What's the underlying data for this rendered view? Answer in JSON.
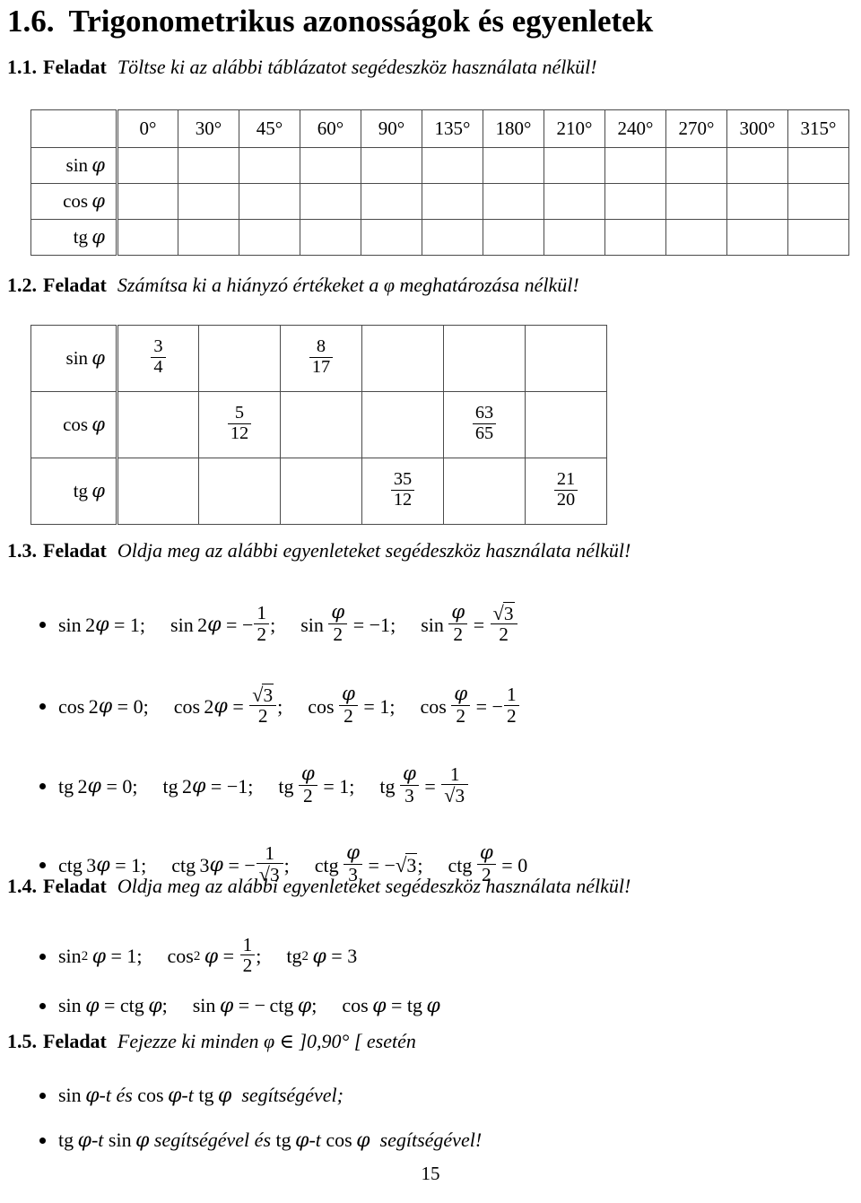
{
  "chapter": {
    "number": "1.6.",
    "title": "Trigonometrikus azonosságok és egyenletek"
  },
  "tasks": {
    "t1": {
      "number": "1.1.",
      "word": "Feladat",
      "desc": "Töltse ki az alábbi táblázatot segédeszköz használata nélkül!"
    },
    "t2": {
      "number": "1.2.",
      "word": "Feladat",
      "desc": "Számítsa ki a hiányzó értékeket a φ meghatározása nélkül!"
    },
    "t3": {
      "number": "1.3.",
      "word": "Feladat",
      "desc": "Oldja meg az alábbi egyenleteket segédeszköz használata nélkül!"
    },
    "t4": {
      "number": "1.4.",
      "word": "Feladat",
      "desc": "Oldja meg az alábbi egyenleteket segédeszköz használata nélkül!"
    },
    "t5": {
      "number": "1.5.",
      "word": "Feladat",
      "desc": "Fejezze ki minden φ ∈ ]0,90° [ esetén"
    }
  },
  "angle_table": {
    "corner": "",
    "angles": [
      "0°",
      "30°",
      "45°",
      "60°",
      "90°",
      "135°",
      "180°",
      "210°",
      "240°",
      "270°",
      "300°",
      "315°"
    ],
    "rows": [
      {
        "label_fn": "sin",
        "label_arg": "φ",
        "cells": [
          "",
          "",
          "",
          "",
          "",
          "",
          "",
          "",
          "",
          "",
          "",
          ""
        ]
      },
      {
        "label_fn": "cos",
        "label_arg": "φ",
        "cells": [
          "",
          "",
          "",
          "",
          "",
          "",
          "",
          "",
          "",
          "",
          "",
          ""
        ]
      },
      {
        "label_fn": "tg",
        "label_arg": "φ",
        "cells": [
          "",
          "",
          "",
          "",
          "",
          "",
          "",
          "",
          "",
          "",
          "",
          ""
        ]
      }
    ]
  },
  "value_table": {
    "column_count": 6,
    "rows": [
      {
        "label_fn": "sin",
        "label_arg": "φ",
        "cells": [
          {
            "num": "3",
            "den": "4"
          },
          {
            "num": "",
            "den": ""
          },
          {
            "num": "8",
            "den": "17"
          },
          {
            "num": "",
            "den": ""
          },
          {
            "num": "",
            "den": ""
          },
          {
            "num": "",
            "den": ""
          }
        ]
      },
      {
        "label_fn": "cos",
        "label_arg": "φ",
        "cells": [
          {
            "num": "",
            "den": ""
          },
          {
            "num": "5",
            "den": "12"
          },
          {
            "num": "",
            "den": ""
          },
          {
            "num": "",
            "den": ""
          },
          {
            "num": "63",
            "den": "65"
          },
          {
            "num": "",
            "den": ""
          }
        ]
      },
      {
        "label_fn": "tg",
        "label_arg": "φ",
        "cells": [
          {
            "num": "",
            "den": ""
          },
          {
            "num": "",
            "den": ""
          },
          {
            "num": "",
            "den": ""
          },
          {
            "num": "35",
            "den": "12"
          },
          {
            "num": "",
            "den": ""
          },
          {
            "num": "21",
            "den": "20"
          }
        ]
      }
    ]
  },
  "eq13": {
    "line1": {
      "e1": {
        "fn": "sin",
        "arg_pre": "2",
        "arg": "φ",
        "rel": "=",
        "rhs": "1",
        "term": ";"
      },
      "e2": {
        "fn": "sin",
        "arg_pre": "2",
        "arg": "φ",
        "rel": "=",
        "sign": "−",
        "num": "1",
        "den": "2",
        "term": ";"
      },
      "e3": {
        "fn": "sin",
        "arg": "φ",
        "arg_den": "2",
        "rel": "=",
        "rhs": "−1",
        "term": ";"
      },
      "e4": {
        "fn": "sin",
        "arg": "φ",
        "arg_den": "2",
        "rel": "=",
        "num_sqrt": "3",
        "den": "2",
        "term": ""
      }
    },
    "line2": {
      "e1": {
        "fn": "cos",
        "arg_pre": "2",
        "arg": "φ",
        "rel": "=",
        "rhs": "0",
        "term": ";"
      },
      "e2": {
        "fn": "cos",
        "arg_pre": "2",
        "arg": "φ",
        "rel": "=",
        "num_sqrt": "3",
        "den": "2",
        "term": ";"
      },
      "e3": {
        "fn": "cos",
        "arg": "φ",
        "arg_den": "2",
        "rel": "=",
        "rhs": "1",
        "term": ";"
      },
      "e4": {
        "fn": "cos",
        "arg": "φ",
        "arg_den": "2",
        "rel": "=",
        "sign": "−",
        "num": "1",
        "den": "2",
        "term": ""
      }
    },
    "line3": {
      "e1": {
        "fn": "tg",
        "arg_pre": "2",
        "arg": "φ",
        "rel": "=",
        "rhs": "0",
        "term": ";"
      },
      "e2": {
        "fn": "tg",
        "arg_pre": "2",
        "arg": "φ",
        "rel": "=",
        "rhs": "−1",
        "term": ";"
      },
      "e3": {
        "fn": "tg",
        "arg": "φ",
        "arg_den": "2",
        "rel": "=",
        "rhs": "1",
        "term": ";"
      },
      "e4": {
        "fn": "tg",
        "arg": "φ",
        "arg_den": "3",
        "rel": "=",
        "num": "1",
        "den_sqrt": "3",
        "term": ""
      }
    },
    "line4": {
      "e1": {
        "fn": "ctg",
        "arg_pre": "3",
        "arg": "φ",
        "rel": "=",
        "rhs": "1",
        "term": ";"
      },
      "e2": {
        "fn": "ctg",
        "arg_pre": "3",
        "arg": "φ",
        "rel": "=",
        "sign": "−",
        "num": "1",
        "den_sqrt": "3",
        "term": ";"
      },
      "e3": {
        "fn": "ctg",
        "arg": "φ",
        "arg_den": "3",
        "rel": "=",
        "rhs_sign": "−",
        "rhs_sqrt": "3",
        "term": ";"
      },
      "e4": {
        "fn": "ctg",
        "arg": "φ",
        "arg_den": "2",
        "rel": "=",
        "rhs": "0",
        "term": ""
      }
    }
  },
  "eq14": {
    "line1": {
      "e1": {
        "fn": "sin",
        "power": "2",
        "arg": "φ",
        "rel": "=",
        "rhs": "1",
        "term": ";"
      },
      "e2": {
        "fn": "cos",
        "power": "2",
        "arg": "φ",
        "rel": "=",
        "num": "1",
        "den": "2",
        "term": ";"
      },
      "e3": {
        "fn": "tg",
        "power": "2",
        "arg": "φ",
        "rel": "=",
        "rhs": "3",
        "term": ""
      }
    },
    "line2": {
      "e1": {
        "lhs_fn": "sin",
        "lhs_arg": "φ",
        "rel": "=",
        "rhs_fn": "ctg",
        "rhs_arg": "φ",
        "term": ";"
      },
      "e2": {
        "lhs_fn": "sin",
        "lhs_arg": "φ",
        "rel": "=",
        "sign": "−",
        "rhs_fn": "ctg",
        "rhs_arg": "φ",
        "term": ";"
      },
      "e3": {
        "lhs_fn": "cos",
        "lhs_arg": "φ",
        "rel": "=",
        "rhs_fn": "tg",
        "rhs_arg": "φ",
        "term": ""
      }
    }
  },
  "eq15": {
    "line1": {
      "a_fn": "sin",
      "a_arg": "φ",
      "a_suffix": "-t",
      "conj": "és",
      "b_fn": "cos",
      "b_arg": "φ",
      "b_suffix": "-t",
      "c_fn": "tg",
      "c_arg": "φ",
      "tail": "segítségével;"
    },
    "line2": {
      "a_fn": "tg",
      "a_arg": "φ",
      "a_suffix": "-t",
      "b_fn": "sin",
      "b_arg": "φ",
      "mid": "segítségével és",
      "c_fn": "tg",
      "c_arg": "φ",
      "c_suffix": "-t",
      "d_fn": "cos",
      "d_arg": "φ",
      "tail": "segítségével!"
    }
  },
  "footer": {
    "page_number": "15"
  }
}
